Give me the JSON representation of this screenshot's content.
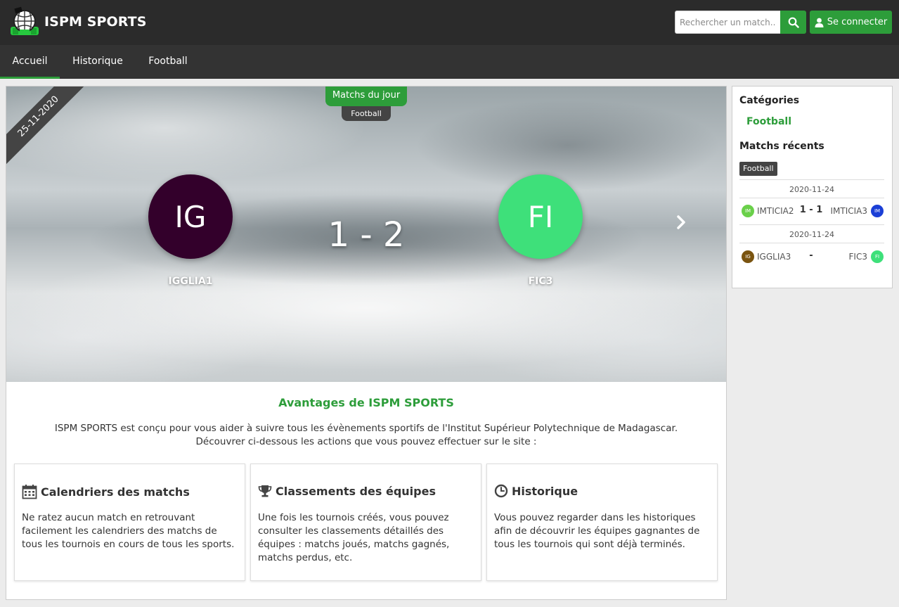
{
  "app": {
    "brand": "ISPM SPORTS",
    "search_placeholder": "Rechercher un match...",
    "login_label": "Se connecter"
  },
  "tabs": [
    {
      "label": "Accueil",
      "active": true
    },
    {
      "label": "Historique",
      "active": false
    },
    {
      "label": "Football",
      "active": false
    }
  ],
  "hero": {
    "date": "25-11-2020",
    "badge": "Matchs du jour",
    "sport": "Football",
    "home": {
      "abbr": "IG",
      "name": "IGGLIA1",
      "color": "#33002b"
    },
    "away": {
      "abbr": "FI",
      "name": "FIC3",
      "color": "#3ee07a"
    },
    "score": "1 - 2"
  },
  "advantages": {
    "title": "Avantages de ISPM SPORTS",
    "line1": "ISPM SPORTS est conçu pour vous aider à suivre tous les évènements sportifs de l'Institut Supérieur Polytechnique de Madagascar.",
    "line2": "Découvrer ci-dessous les actions que vous pouvez effectuer sur le site :",
    "cards": [
      {
        "icon": "calendar-icon",
        "title": "Calendriers des matchs",
        "text": "Ne ratez aucun match en retrouvant facilement les calendriers des matchs de tous les tournois en cours de tous les sports."
      },
      {
        "icon": "trophy-icon",
        "title": "Classements des équipes",
        "text": "Une fois les tournois créés, vous pouvez consulter les classements détaillés des équipes : matchs joués, matchs gagnés, matchs perdus, etc."
      },
      {
        "icon": "clock-icon",
        "title": "Historique",
        "text": "Vous pouvez regarder dans les historiques afin de découvrir les équipes gagnantes de tous les tournois qui sont déjà terminés."
      }
    ]
  },
  "sidebar": {
    "categories_title": "Catégories",
    "category": "Football",
    "recent_title": "Matchs récents",
    "recent_tag": "Football",
    "matches": [
      {
        "date": "2020-11-24",
        "home": "IMTICIA2",
        "home_abbr": "IM",
        "home_color": "#6ad04a",
        "score": "1 - 1",
        "away": "IMTICIA3",
        "away_abbr": "IM",
        "away_color": "#1b3fd6"
      },
      {
        "date": "2020-11-24",
        "home": "IGGLIA3",
        "home_abbr": "IG",
        "home_color": "#7a5410",
        "score": "-",
        "away": "FIC3",
        "away_abbr": "FI",
        "away_color": "#3ee07a"
      }
    ]
  },
  "colors": {
    "accent": "#2d9d3a",
    "navbar": "#2b2b2b",
    "tabbar": "#333333"
  }
}
